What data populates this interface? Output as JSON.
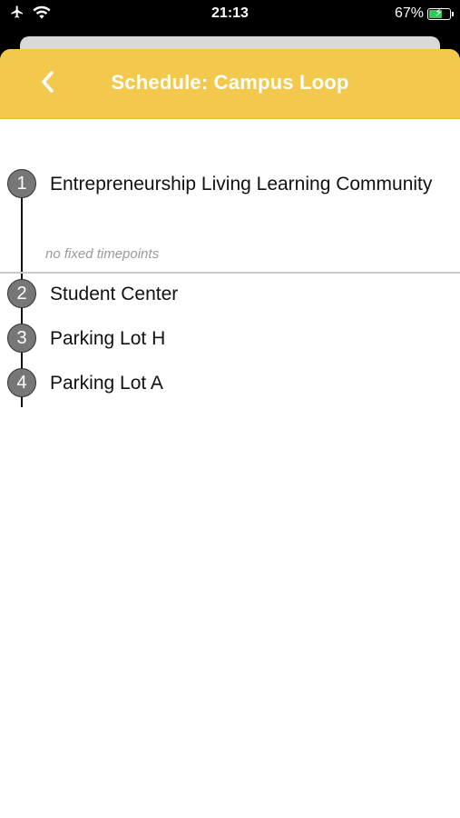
{
  "status_bar": {
    "time": "21:13",
    "battery_percent": "67%",
    "battery_level": 0.67,
    "airplane_icon": "airplane-icon",
    "wifi_icon": "wifi-icon"
  },
  "nav": {
    "title": "Schedule: Campus Loop",
    "back_icon": "chevron-left-icon",
    "accent_color": "#f2c94c"
  },
  "route": {
    "stops": [
      {
        "number": "1",
        "name": "Entrepreneurship Living Learning Community"
      },
      {
        "number": "2",
        "name": "Student Center"
      },
      {
        "number": "3",
        "name": "Parking Lot H"
      },
      {
        "number": "4",
        "name": "Parking Lot A"
      }
    ],
    "no_timepoints_note": "no fixed timepoints"
  }
}
